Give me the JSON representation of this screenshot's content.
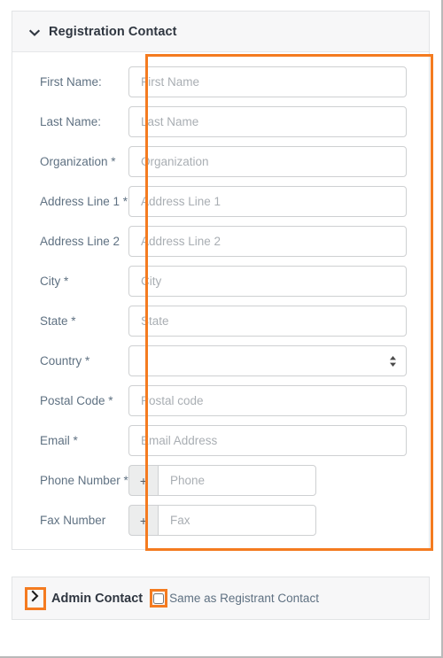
{
  "card": {
    "header": {
      "title": "Registration Contact",
      "toggle_icon": "chevron-down-icon",
      "expanded": true
    },
    "fields": [
      {
        "label": "First Name:",
        "placeholder": "First Name",
        "value": "",
        "type": "text",
        "required": false
      },
      {
        "label": "Last Name:",
        "placeholder": "Last Name",
        "value": "",
        "type": "text",
        "required": false
      },
      {
        "label": "Organization *",
        "placeholder": "Organization",
        "value": "",
        "type": "text",
        "required": true
      },
      {
        "label": "Address Line 1 *",
        "placeholder": "Address Line 1",
        "value": "",
        "type": "text",
        "required": true
      },
      {
        "label": "Address Line 2",
        "placeholder": "Address Line 2",
        "value": "",
        "type": "text",
        "required": false
      },
      {
        "label": "City *",
        "placeholder": "City",
        "value": "",
        "type": "text",
        "required": true
      },
      {
        "label": "State *",
        "placeholder": "State",
        "value": "",
        "type": "text",
        "required": true
      },
      {
        "label": "Country *",
        "placeholder": "",
        "value": "",
        "type": "select",
        "required": true,
        "options": [
          ""
        ]
      },
      {
        "label": "Postal Code *",
        "placeholder": "Postal code",
        "value": "",
        "type": "text",
        "required": true
      },
      {
        "label": "Email *",
        "placeholder": "Email Address",
        "value": "",
        "type": "text",
        "required": true
      },
      {
        "label": "Phone Number *",
        "placeholder": "Phone",
        "value": "",
        "type": "tel",
        "required": true,
        "prefix": "+"
      },
      {
        "label": "Fax Number",
        "placeholder": "Fax",
        "value": "",
        "type": "tel",
        "required": false,
        "prefix": "+"
      }
    ]
  },
  "admin_panel": {
    "toggle_icon": "chevron-right-icon",
    "title": "Admin Contact",
    "checkbox": {
      "label": "Same as Registrant Contact",
      "checked": false
    }
  },
  "highlights": {
    "color": "#f47b20",
    "regions": [
      "registration-inputs-column",
      "admin-contact-toggle",
      "same-as-registrant-checkbox"
    ]
  }
}
